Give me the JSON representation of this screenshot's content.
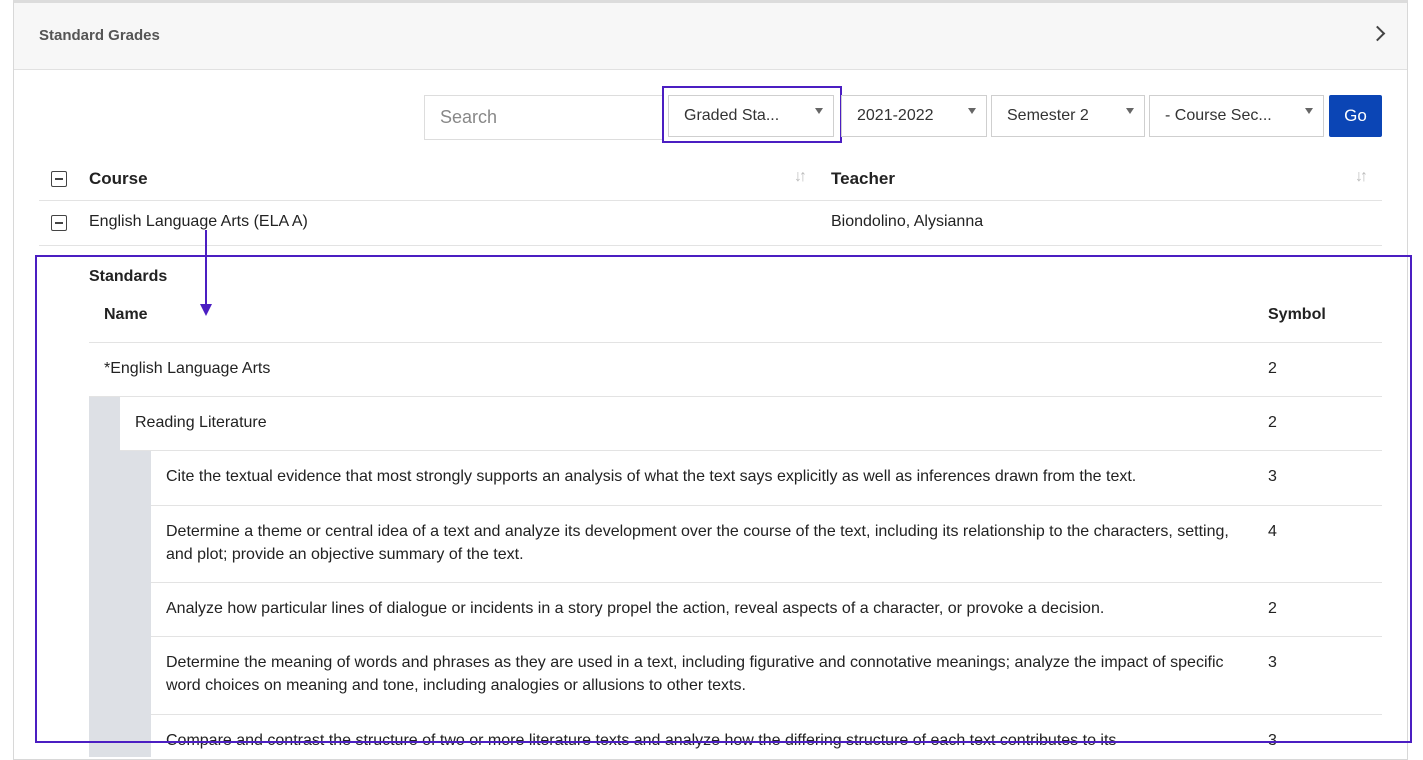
{
  "panel": {
    "title": "Standard Grades"
  },
  "filters": {
    "search_placeholder": "Search",
    "type_select": "Graded Sta...",
    "year_select": "2021-2022",
    "term_select": "Semester 2",
    "section_select": "- Course Sec...",
    "go_label": "Go"
  },
  "table": {
    "col_course": "Course",
    "col_teacher": "Teacher",
    "row": {
      "course": "English Language Arts (ELA A)",
      "teacher": "Biondolino, Alysianna"
    }
  },
  "standards": {
    "heading": "Standards",
    "col_name": "Name",
    "col_symbol": "Symbol",
    "rows": [
      {
        "name": "*English Language Arts",
        "symbol": "2"
      },
      {
        "name": "Reading Literature",
        "symbol": "2"
      },
      {
        "name": "Cite the textual evidence that most strongly supports an analysis of what the text says explicitly as well as inferences drawn from the text.",
        "symbol": "3"
      },
      {
        "name": "Determine a theme or central idea of a text and analyze its development over the course of the text, including its relationship to the characters, setting, and plot; provide an objective summary of the text.",
        "symbol": "4"
      },
      {
        "name": "Analyze how particular lines of dialogue or incidents in a story propel the action, reveal aspects of a character, or provoke a decision.",
        "symbol": "2"
      },
      {
        "name": "Determine the meaning of words and phrases as they are used in a text, including figurative and connotative meanings; analyze the impact of specific word choices on meaning and tone, including analogies or allusions to other texts.",
        "symbol": "3"
      },
      {
        "name": "Compare and contrast the structure of two or more literature texts and analyze how the differing structure of each text contributes to its",
        "symbol": "3"
      }
    ]
  },
  "colors": {
    "accent": "#4b1ec2",
    "go_button": "#0b45b5",
    "indent_strip": "#dde0e5"
  }
}
